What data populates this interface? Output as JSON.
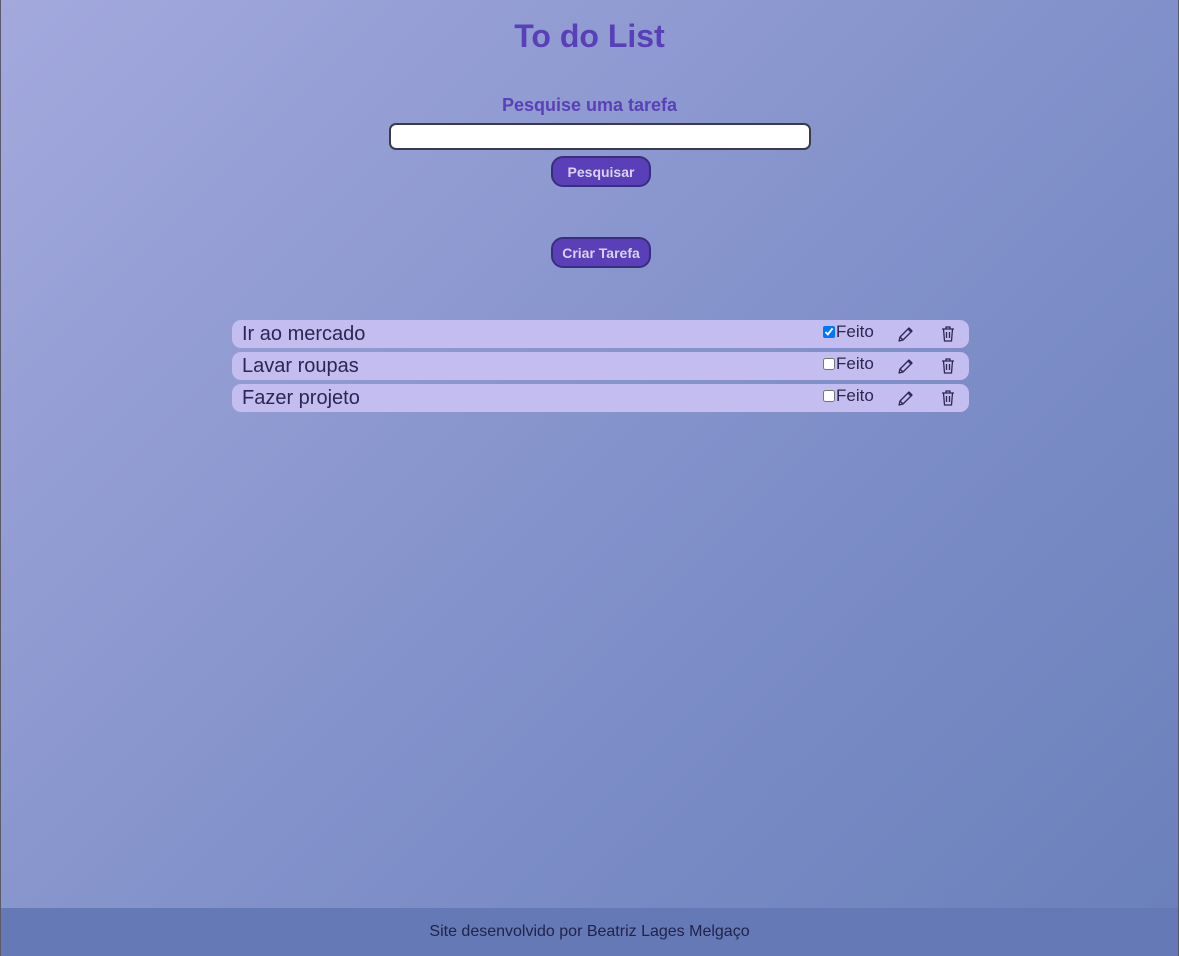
{
  "header": {
    "title": "To do List"
  },
  "search": {
    "label": "Pesquise uma tarefa",
    "value": "",
    "button_label": "Pesquisar"
  },
  "actions": {
    "create_label": "Criar Tarefa"
  },
  "tasks": [
    {
      "name": "Ir ao mercado",
      "done_label": "Feito",
      "done": true
    },
    {
      "name": "Lavar roupas",
      "done_label": "Feito",
      "done": false
    },
    {
      "name": "Fazer projeto",
      "done_label": "Feito",
      "done": false
    }
  ],
  "icons": {
    "edit": "pencil-icon",
    "delete": "trash-icon"
  },
  "footer": {
    "text": "Site desenvolvido por Beatriz Lages Melgaço"
  },
  "colors": {
    "accent": "#5a40b8",
    "task_background": "#c4bdef",
    "footer_background": "#6479b5"
  }
}
